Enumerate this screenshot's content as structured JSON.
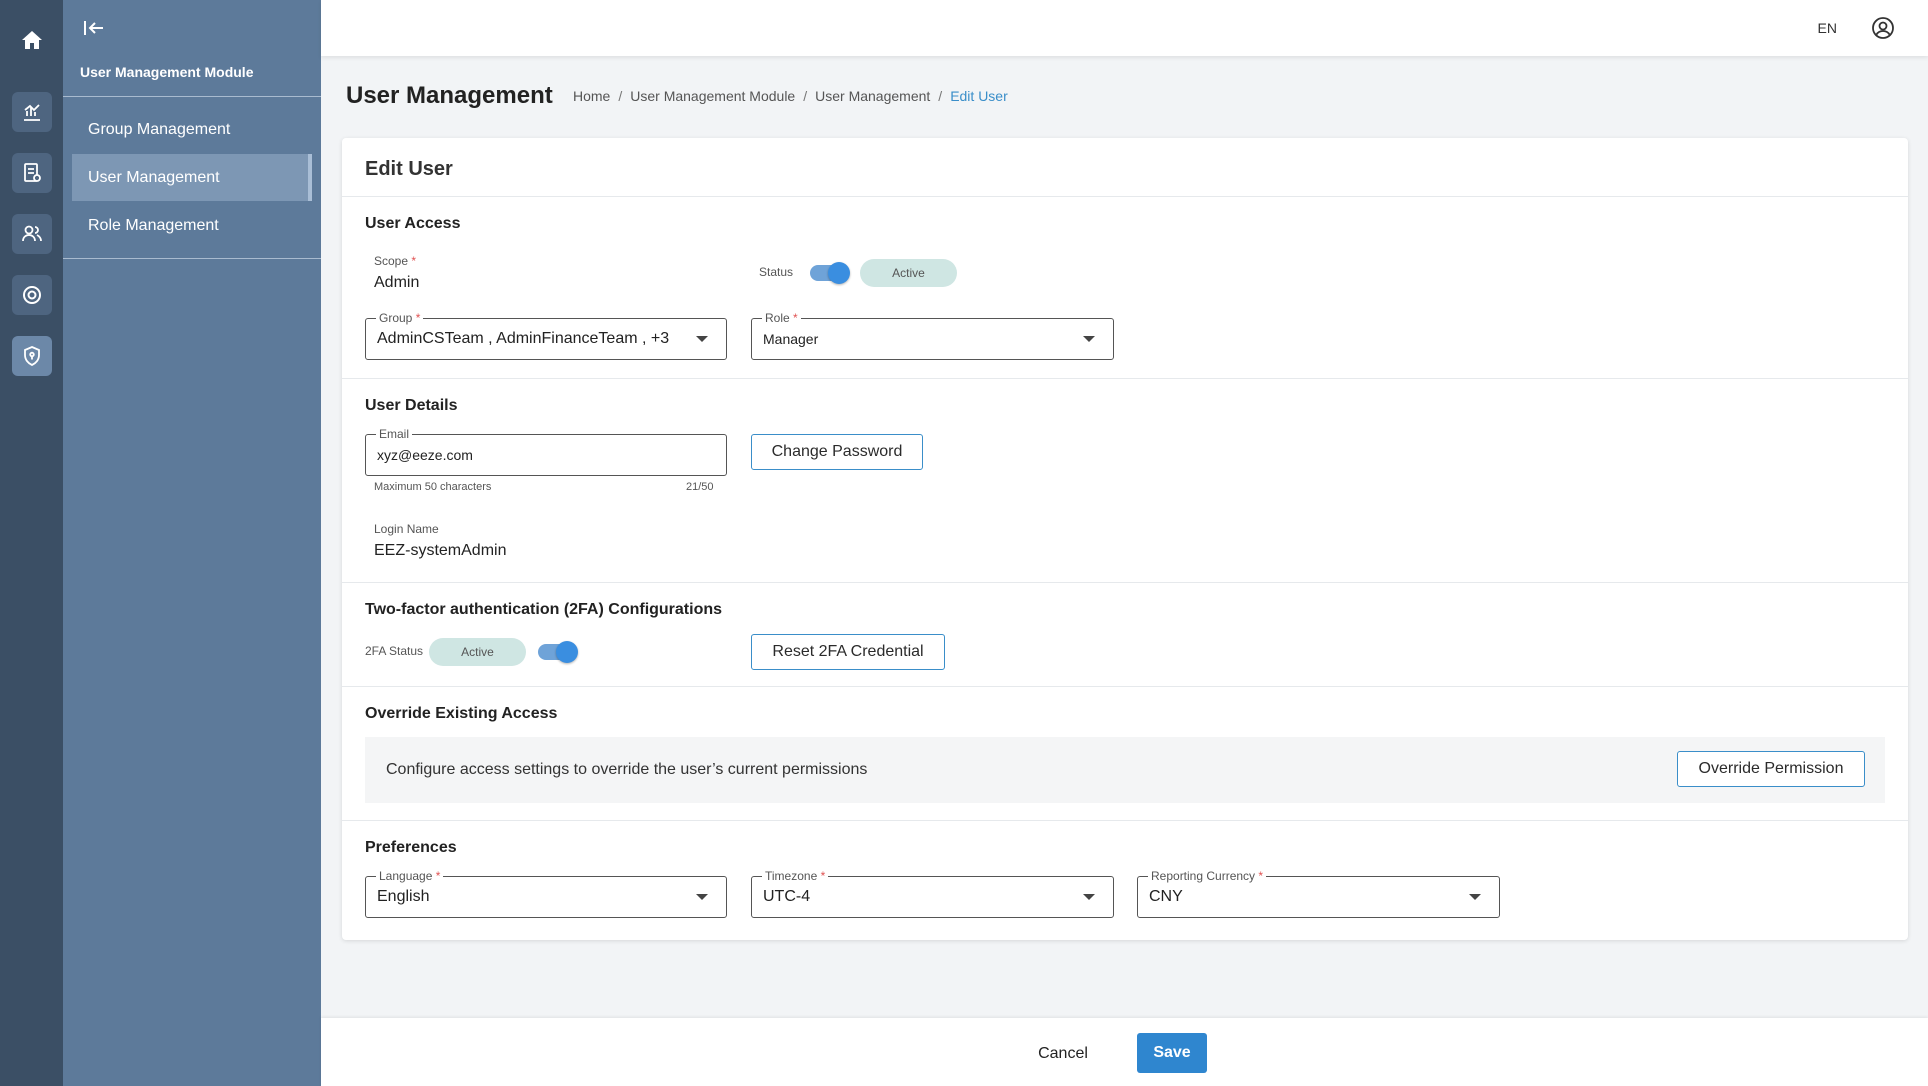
{
  "topbar": {
    "language": "EN"
  },
  "sidebar": {
    "module_title": "User Management Module",
    "items": [
      {
        "label": "Group Management"
      },
      {
        "label": "User Management"
      },
      {
        "label": "Role Management"
      }
    ]
  },
  "header": {
    "title": "User Management",
    "breadcrumb": [
      "Home",
      "User Management Module",
      "User Management",
      "Edit User"
    ],
    "separator": "/"
  },
  "card": {
    "title": "Edit User",
    "user_access": {
      "section_title": "User Access",
      "scope_label": "Scope",
      "scope_value": "Admin",
      "status_label": "Status",
      "status_badge": "Active",
      "status_on": true,
      "group_label": "Group",
      "group_value": "AdminCSTeam , AdminFinanceTeam , +3",
      "role_label": "Role",
      "role_value": "Manager"
    },
    "user_details": {
      "section_title": "User Details",
      "email_label": "Email",
      "email_value": "xyz@eeze.com",
      "email_helper": "Maximum 50 characters",
      "email_counter": "21/50",
      "change_password": "Change Password",
      "login_name_label": "Login Name",
      "login_name_value": "EEZ-systemAdmin"
    },
    "twofa": {
      "section_title": "Two-factor authentication (2FA) Configurations",
      "status_label": "2FA Status",
      "status_badge": "Active",
      "status_on": true,
      "reset_button": "Reset 2FA Credential"
    },
    "override": {
      "section_title": "Override Existing Access",
      "description": "Configure access settings to override the user’s current permissions",
      "button": "Override Permission"
    },
    "preferences": {
      "section_title": "Preferences",
      "language_label": "Language",
      "language_value": "English",
      "timezone_label": "Timezone",
      "timezone_value": "UTC-4",
      "currency_label": "Reporting Currency",
      "currency_value": "CNY"
    },
    "required_mark": "*"
  },
  "footer": {
    "cancel": "Cancel",
    "save": "Save"
  },
  "colors": {
    "accent": "#2f86cf",
    "rail": "#3b4f65",
    "sidebar": "#5d7a9a",
    "badge": "#cfe6e3"
  }
}
